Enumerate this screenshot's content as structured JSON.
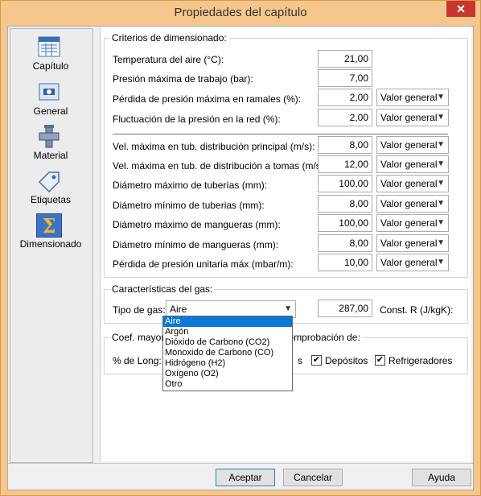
{
  "window": {
    "title": "Propiedades del capítulo",
    "close_glyph": "✕"
  },
  "sidebar": {
    "items": [
      {
        "label": "Capítulo",
        "icon": "document-grid-icon"
      },
      {
        "label": "General",
        "icon": "general-settings-icon"
      },
      {
        "label": "Material",
        "icon": "pipe-fitting-icon"
      },
      {
        "label": "Etiquetas",
        "icon": "tag-icon"
      },
      {
        "label": "Dimensionado",
        "icon": "sigma-icon",
        "active": true
      }
    ]
  },
  "criterios": {
    "title": "Criterios de dimensionado:",
    "rows": [
      {
        "label": "Temperatura del aire (°C):",
        "value": "21,00"
      },
      {
        "label": "Presión máxima de trabajo (bar):",
        "value": "7,00"
      },
      {
        "label": "Pérdida de presión máxima en ramales (%):",
        "value": "2,00",
        "combo": "Valor general"
      },
      {
        "label": "Fluctuación de la presión en la red (%):",
        "value": "2,00",
        "combo": "Valor general"
      },
      {
        "label": "Vel. máxima en tub. distribución principal (m/s):",
        "value": "8,00",
        "combo": "Valor general"
      },
      {
        "label": "Vel. máxima en tub. de distribución a tomas (m/s):",
        "value": "12,00",
        "combo": "Valor general"
      },
      {
        "label": "Diámetro máximo de tuberías (mm):",
        "value": "100,00",
        "combo": "Valor general"
      },
      {
        "label": "Diámetro mínimo de tuberias (mm):",
        "value": "8,00",
        "combo": "Valor general"
      },
      {
        "label": "Diámetro máximo de mangueras (mm):",
        "value": "100,00",
        "combo": "Valor general"
      },
      {
        "label": "Diámetro mínimo de mangueras (mm):",
        "value": "8,00",
        "combo": "Valor general"
      },
      {
        "label": "Pérdida de presión unitaria máx (mbar/m):",
        "value": "10,00",
        "combo": "Valor general"
      }
    ]
  },
  "gas": {
    "title": "Características del gas:",
    "tipo_label": "Tipo de gas:",
    "tipo_value": "Aire",
    "const_value": "287,00",
    "const_label": "Const. R (J/kgK):",
    "options": [
      "Aire",
      "Argón",
      "Dióxido de Carbono (CO2)",
      "Monoxido de Carbono (CO)",
      "Hidrógeno (H2)",
      "Oxígeno (O2)",
      "Otro"
    ],
    "selected_index": 0
  },
  "coef": {
    "title_start": "Coef. mayoracio",
    "title_end": "do y comprobación de:",
    "long_label": "% de Long:",
    "s_fragment": "s",
    "depositos_label": "Depósitos",
    "depositos_checked": true,
    "refrigeradores_label": "Refrigeradores",
    "refrigeradores_checked": true,
    "check_glyph": "✔"
  },
  "buttons": {
    "aceptar": "Aceptar",
    "cancelar": "Cancelar",
    "ayuda": "Ayuda"
  }
}
